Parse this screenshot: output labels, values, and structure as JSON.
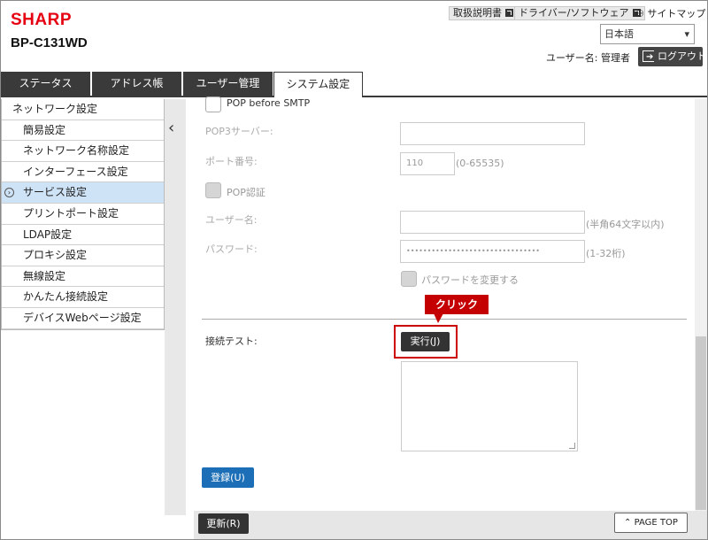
{
  "header": {
    "brand": "SHARP",
    "model": "BP-C131WD",
    "manual_label": "取扱説明書",
    "driver_label": "ドライバー/ソフトウェア",
    "sitemap_label": "サイトマップ",
    "language": "日本語",
    "user_text": "ユーザー名: 管理者",
    "logout_label": "ログアウト"
  },
  "tabs": [
    {
      "label": "ステータス"
    },
    {
      "label": "アドレス帳"
    },
    {
      "label": "ユーザー管理"
    },
    {
      "label": "システム設定"
    }
  ],
  "sidebar": {
    "header": "ネットワーク設定",
    "items": [
      {
        "label": "簡易設定"
      },
      {
        "label": "ネットワーク名称設定"
      },
      {
        "label": "インターフェース設定"
      },
      {
        "label": "サービス設定"
      },
      {
        "label": "プリントポート設定"
      },
      {
        "label": "LDAP設定"
      },
      {
        "label": "プロキシ設定"
      },
      {
        "label": "無線設定"
      },
      {
        "label": "かんたん接続設定"
      },
      {
        "label": "デバイスWebページ設定"
      }
    ]
  },
  "form": {
    "pop_before_smtp": "POP before SMTP",
    "pop3_server_label": "POP3サーバー:",
    "port_label": "ポート番号:",
    "port_value": "110",
    "port_hint": "(0-65535)",
    "pop_auth": "POP認証",
    "username_label": "ユーザー名:",
    "username_hint": "(半角64文字以内)",
    "password_label": "パスワード:",
    "password_value": "••••••••••••••••••••••••••••••••",
    "password_hint": "(1-32桁)",
    "change_password": "パスワードを変更する",
    "conn_test_label": "接続テスト:",
    "run_button": "実行(J)",
    "register_button": "登録(U)"
  },
  "annotation": {
    "callout": "クリック"
  },
  "footer": {
    "refresh_button": "更新(R)",
    "page_top": "PAGE TOP"
  }
}
